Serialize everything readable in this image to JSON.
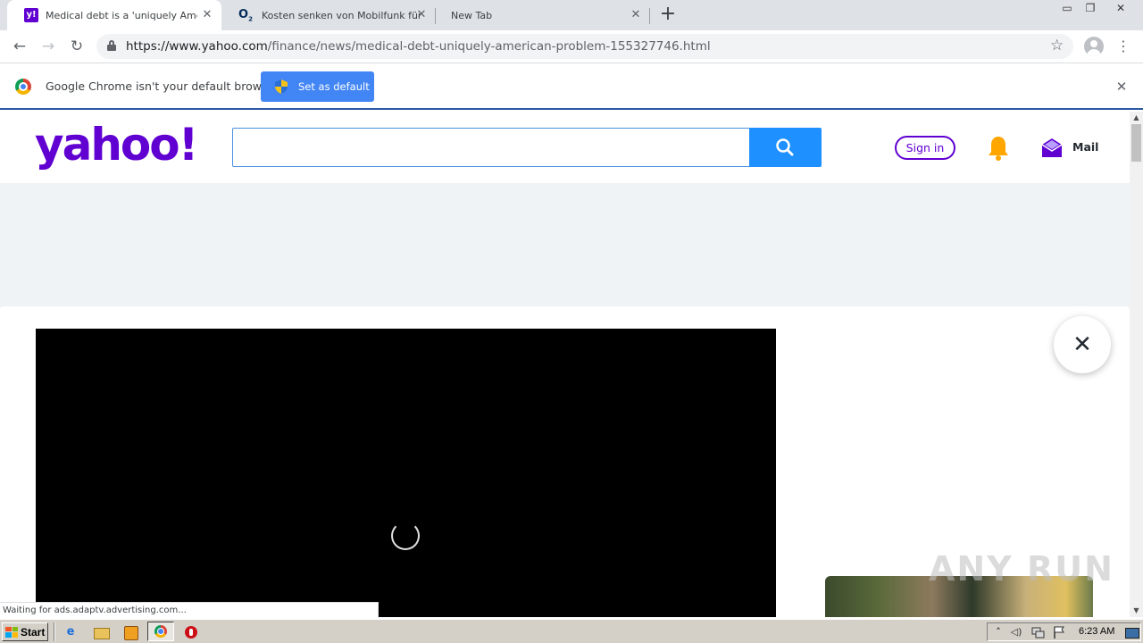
{
  "tabs": [
    {
      "title": "Medical debt is a 'uniquely American",
      "icon": "yahoo-favicon",
      "active": true
    },
    {
      "title": "Kosten senken von Mobilfunk für Ge",
      "icon": "o2-favicon",
      "active": false
    },
    {
      "title": "New Tab",
      "icon": "none",
      "active": false
    }
  ],
  "tab_close_glyph": "✕",
  "new_tab_glyph": "+",
  "window": {
    "min": "▭",
    "max": "❐",
    "close": "✕"
  },
  "toolbar": {
    "back": "←",
    "forward": "→",
    "reload": "↻",
    "url_host": "https://www.yahoo.com",
    "url_path": "/finance/news/medical-debt-uniquely-american-problem-155327746.html",
    "star": "☆",
    "menu": "⋮"
  },
  "infobar": {
    "message": "Google Chrome isn't your default browser",
    "button_label": "Set as default",
    "close_glyph": "✕"
  },
  "yahoo": {
    "logo_text": "yahoo!",
    "search_value": "",
    "signin_label": "Sign in",
    "mail_label": "Mail",
    "brand_color": "#6001d2",
    "search_button_color": "#1e90ff"
  },
  "ad_close_glyph": "✕",
  "watermark": "ANY RUN",
  "status_text": "Waiting for ads.adaptv.advertising.com...",
  "scrollbar": {
    "up": "▲",
    "down": "▼"
  },
  "taskbar": {
    "start_label": "Start",
    "ie_glyph": "e",
    "tray_up": "˄",
    "tray_vol": "◁)",
    "clock": "6:23 AM"
  }
}
